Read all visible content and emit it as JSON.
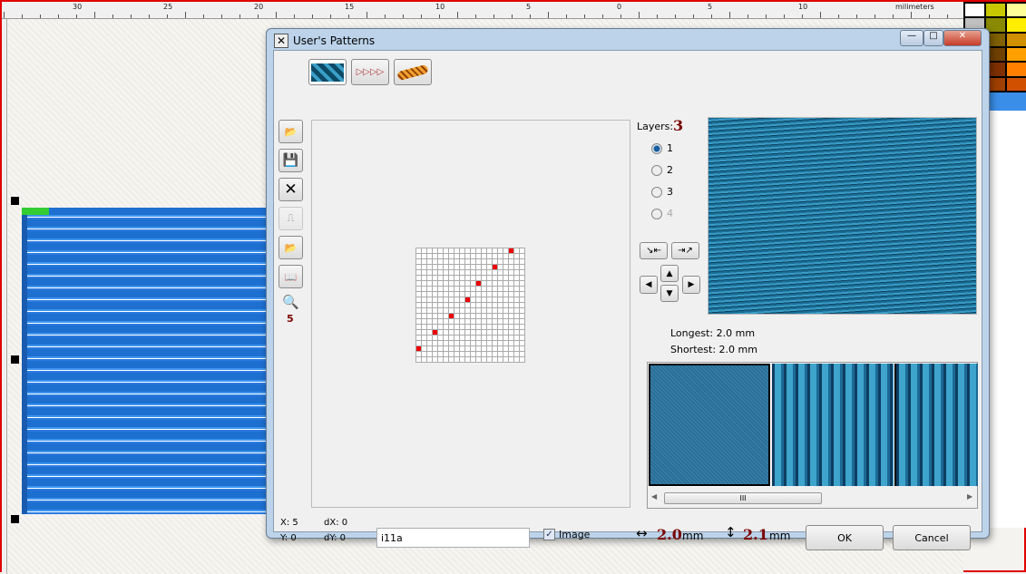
{
  "ruler": {
    "labels": [
      "30",
      "25",
      "20",
      "15",
      "10",
      "5",
      "0",
      "5",
      "10"
    ],
    "unit": "milimeters"
  },
  "palette_colors": [
    "#ffffff",
    "#c8c800",
    "#ffff99",
    "#c0c0c0",
    "#8a8a00",
    "#ffee00",
    "#a06040",
    "#806000",
    "#d09000",
    "#603018",
    "#704000",
    "#ffa000",
    "#402010",
    "#803000",
    "#ff8000",
    "#503020",
    "#a04000",
    "#d05000"
  ],
  "dialog": {
    "title": "User's Patterns",
    "window_controls": {
      "minimize": "—",
      "maximize": "□",
      "close": "✕"
    },
    "tabs": [
      {
        "name": "pattern-fill"
      },
      {
        "name": "motif-line"
      },
      {
        "name": "rope"
      }
    ],
    "tools": {
      "zoom_value": "5"
    },
    "grid": {
      "cols": 20,
      "rows": 21,
      "points": [
        [
          17,
          0
        ],
        [
          14,
          3
        ],
        [
          11,
          6
        ],
        [
          9,
          9
        ],
        [
          6,
          12
        ],
        [
          3,
          15
        ],
        [
          0,
          18
        ]
      ]
    },
    "layers": {
      "label": "Layers:",
      "count": "3",
      "options": [
        "1",
        "2",
        "3",
        "4"
      ],
      "selected": "1",
      "disabled": [
        "4"
      ]
    },
    "stats": {
      "longest": "Longest: 2.0 mm",
      "shortest": "Shortest: 2.0 mm"
    },
    "scrollbar_grip": "III",
    "coords": {
      "x": "X: 5",
      "y": "Y: 0",
      "dx": "dX: 0",
      "dy": "dY: 0"
    },
    "name_field": "i11a",
    "image_checkbox": {
      "label": "Image",
      "checked": true
    },
    "width": {
      "value": "2.0",
      "unit": "mm"
    },
    "height": {
      "value": "2.1",
      "unit": "mm"
    },
    "ok_label": "OK",
    "cancel_label": "Cancel"
  }
}
